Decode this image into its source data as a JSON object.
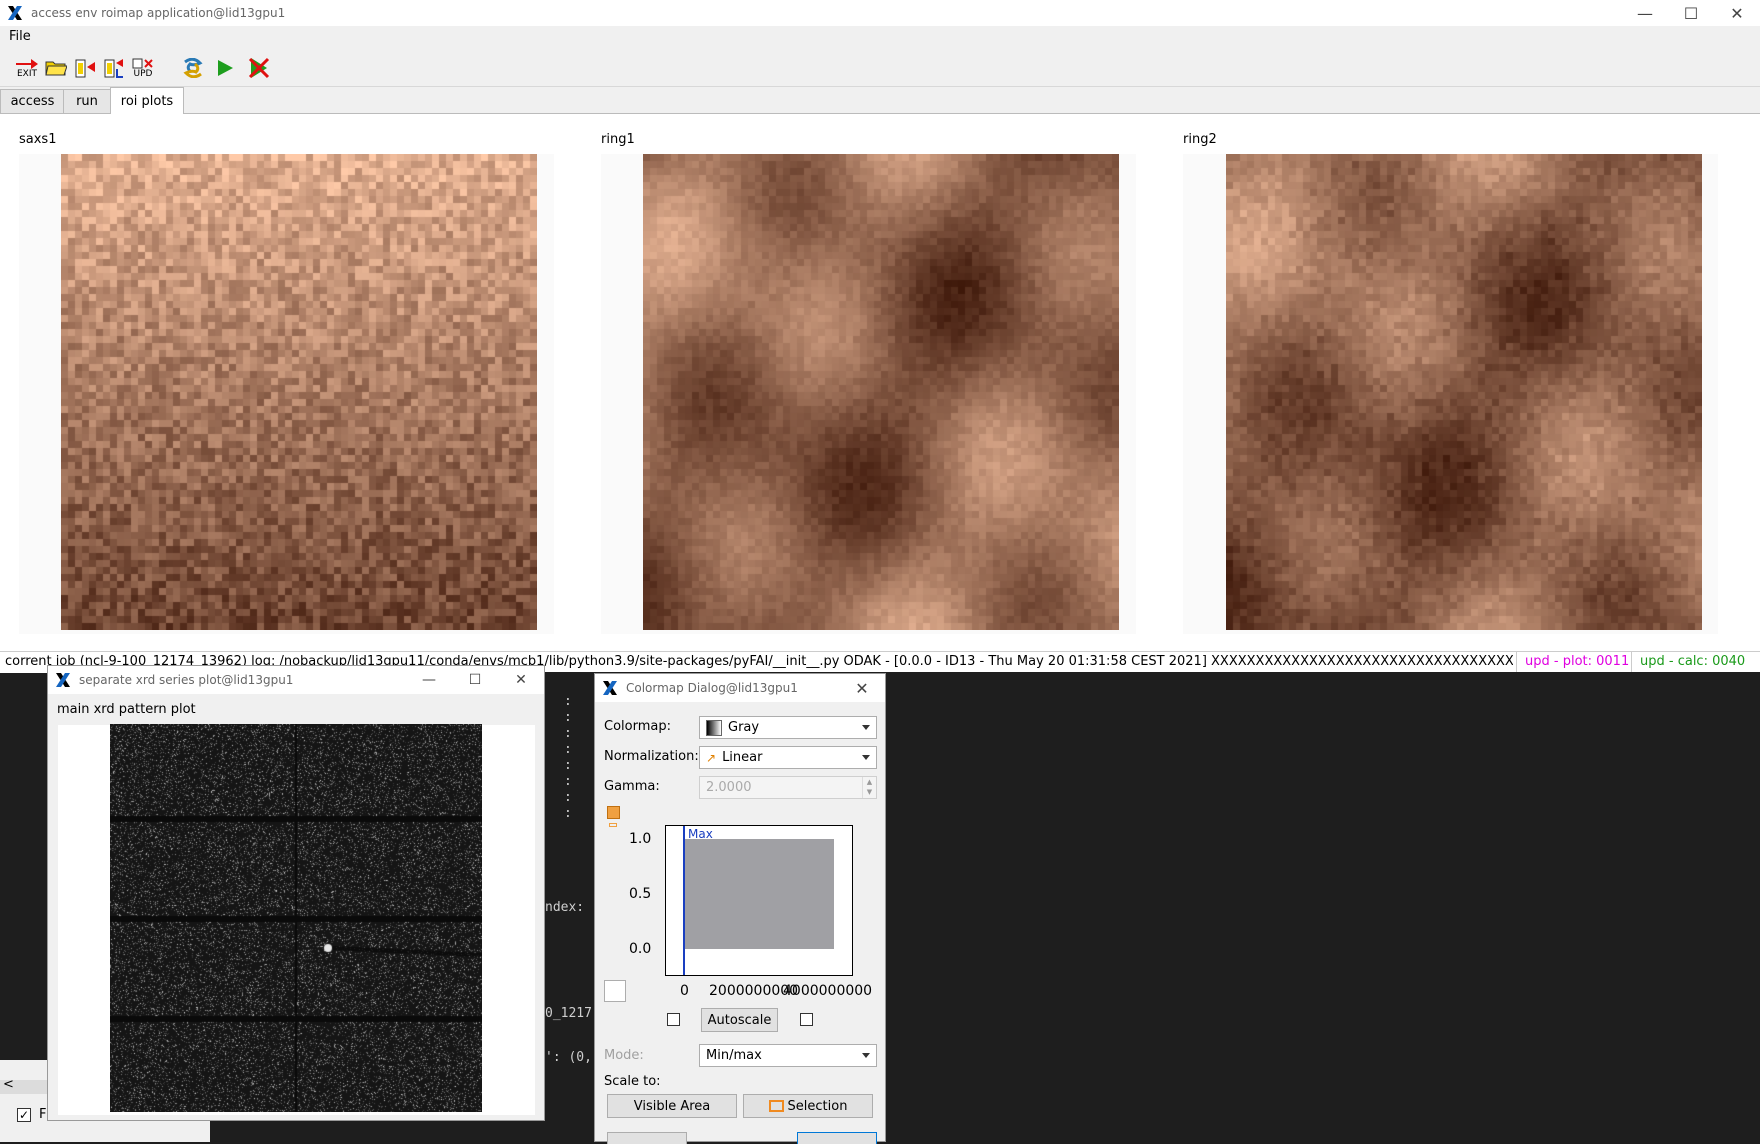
{
  "main_window": {
    "title": "access env roimap application@lid13gpu1",
    "menu": [
      "File"
    ],
    "toolbar": [
      {
        "icon": "exit-icon",
        "label": "EXIT"
      },
      {
        "icon": "open-folder-icon",
        "label": ""
      },
      {
        "icon": "load-red-icon",
        "label": ""
      },
      {
        "icon": "load-l-icon",
        "label": ""
      },
      {
        "icon": "update-icon",
        "label": "UPD"
      },
      {
        "icon": "python-icon",
        "label": ""
      },
      {
        "icon": "play-icon",
        "label": ""
      },
      {
        "icon": "stop-icon",
        "label": ""
      }
    ],
    "tabs": [
      {
        "label": "access",
        "active": false
      },
      {
        "label": "run",
        "active": false
      },
      {
        "label": "roi plots",
        "active": true
      }
    ],
    "plots": [
      {
        "title": "saxs1"
      },
      {
        "title": "ring1"
      },
      {
        "title": "ring2"
      }
    ],
    "status": {
      "text": "corrent job (ncl-9-100_12174_13962) log: /nobackup/lid13gpu11/conda/envs/mcb1/lib/python3.9/site-packages/pyFAI/__init__.py  ODAK - [0.0.0 - ID13 - Thu May 20 01:31:58 CEST 2021] XXXXXXXXXXXXXXXXXXXXXXXXXXXXXXXXXXXXXXXXXXXXXXXXXXXXXXXXXX)",
      "upd_plot": "upd - plot: 0011",
      "upd_calc": "upd - calc: 0040",
      "colors": {
        "upd_plot": "#e000e0",
        "upd_calc": "#1a9a1a"
      }
    }
  },
  "terminal": {
    "lines": [
      ":",
      ":",
      ":",
      ":",
      ":",
      ":",
      ":",
      ":",
      "ndex:",
      "0_1217",
      "': (0,"
    ]
  },
  "left_window": {
    "checkbox_label": "F",
    "scroll_arrow": "<"
  },
  "xrd_window": {
    "title": "separate xrd series plot@lid13gpu1",
    "plot_title": "main xrd pattern plot"
  },
  "colormap_dialog": {
    "title": "Colormap Dialog@lid13gpu1",
    "colormap_label": "Colormap:",
    "colormap_value": "Gray",
    "normalization_label": "Normalization:",
    "normalization_value": "Linear",
    "gamma_label": "Gamma:",
    "gamma_value": "2.0000",
    "histogram": {
      "marker_label": "Max",
      "yticks": [
        "1.0",
        "0.5",
        "0.0"
      ],
      "xticks": [
        "0",
        "2000000000",
        "4000000000"
      ]
    },
    "autoscale_label": "Autoscale",
    "mode_label": "Mode:",
    "mode_value": "Min/max",
    "scale_to_label": "Scale to:",
    "visible_area_label": "Visible Area",
    "selection_label": "Selection"
  }
}
